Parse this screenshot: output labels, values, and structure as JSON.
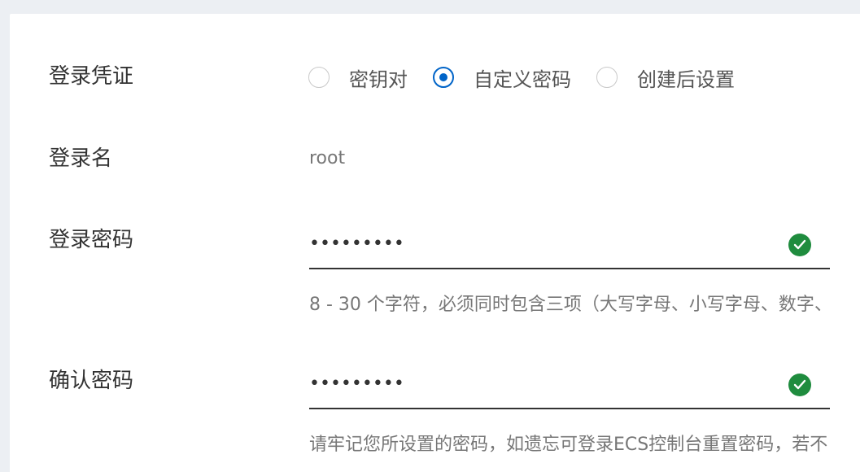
{
  "form": {
    "credential": {
      "label": "登录凭证",
      "options": [
        {
          "label": "密钥对",
          "checked": false
        },
        {
          "label": "自定义密码",
          "checked": true
        },
        {
          "label": "创建后设置",
          "checked": false
        }
      ]
    },
    "login_name": {
      "label": "登录名",
      "value": "root"
    },
    "password": {
      "label": "登录密码",
      "masked_value": "•••••••••",
      "status_icon": "check-circle-icon",
      "help": "8 - 30 个字符，必须同时包含三项（大写字母、小写字母、数字、"
    },
    "confirm_password": {
      "label": "确认密码",
      "masked_value": "•••••••••",
      "status_icon": "check-circle-icon",
      "help": "请牢记您所设置的密码，如遗忘可登录ECS控制台重置密码，若不"
    }
  },
  "colors": {
    "accent": "#0064c8",
    "success": "#1f8c3e",
    "background": "#eceff3"
  }
}
